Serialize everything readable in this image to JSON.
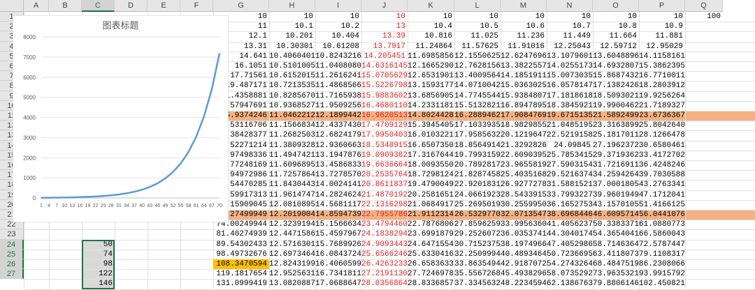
{
  "columns": [
    "A",
    "B",
    "C",
    "D",
    "E",
    "F",
    "G",
    "H",
    "I",
    "J",
    "K",
    "L",
    "M",
    "N",
    "O",
    "P",
    "Q"
  ],
  "selected_column": "C",
  "rows": [
    "1",
    "2",
    "3",
    "4",
    "5",
    "6",
    "7",
    "8",
    "9",
    "10",
    "11",
    "12",
    "13",
    "14",
    "15",
    "16",
    "17",
    "18",
    "19",
    "20",
    "21",
    "22",
    "23",
    "24",
    "25",
    "26",
    "27"
  ],
  "selected_rows": [
    "24",
    "25",
    "26",
    "27"
  ],
  "highlight_rows": [
    "11",
    "21"
  ],
  "colors": {
    "highlight": "#f4b183",
    "red_text": "#e02020",
    "gold": "#ffc000",
    "selection": "#217346",
    "line": "#5b9bd5"
  },
  "grid": [
    [
      "10",
      "10",
      "10",
      "10",
      "10",
      "10",
      "10",
      "10",
      "10",
      "10",
      "100"
    ],
    [
      "11",
      "10.1",
      "10.2",
      "13",
      "10.4",
      "10.5",
      "10.6",
      "10.7",
      "10.8",
      "10.9",
      ""
    ],
    [
      "12.1",
      "10.201",
      "10.404",
      "13.39",
      "10.816",
      "11.025",
      "11.236",
      "11.449",
      "11.664",
      "11.881",
      ""
    ],
    [
      "13.31",
      "10.30301",
      "10.61208",
      "13.7917",
      "11.24864",
      "11.57625",
      "11.91016",
      "12.25043",
      "12.59712",
      "12.95029",
      ""
    ],
    [
      "14.641",
      "10.4060401",
      "10.8243216",
      "14.205451",
      "11.6985856",
      "12.1550625",
      "12.6247696",
      "13.1079601",
      "13.6048896",
      "14.1158161",
      ""
    ],
    [
      "16.1051",
      "10.5101005",
      "11.04080803",
      "14.63161453",
      "12.16652902",
      "12.76281563",
      "13.38225578",
      "14.02551731",
      "14.69328077",
      "15.38623955",
      ""
    ],
    [
      "17.71561",
      "10.61520151",
      "11.26162419",
      "15.07056297",
      "12.65319018",
      "13.40095641",
      "14.18519112",
      "15.00730352",
      "15.86874323",
      "16.77100111",
      ""
    ],
    [
      "19.487171",
      "10.72135352",
      "11.48685668",
      "15.52267985",
      "13.15931779",
      "14.07100423",
      "15.03630259",
      "16.05781476",
      "17.13824269",
      "18.28039121",
      ""
    ],
    [
      "21.4358881",
      "10.82856706",
      "11.71659381",
      "15.98836025",
      "13.6856905",
      "14.77455444",
      "15.93848075",
      "17.1818618",
      "18.5093021",
      "19.92562642",
      ""
    ],
    [
      "23.57947691",
      "10.93685273",
      "11.95092569",
      "16.46801106",
      "14.23311812",
      "15.51328216",
      "16.89478959",
      "18.38459212",
      "19.99004627",
      "21.71893279",
      ""
    ],
    [
      "25.9374246",
      "11.04622125",
      "12.1899442",
      "16.96205139",
      "14.80244285",
      "16.28894627",
      "17.90847697",
      "19.67151357",
      "21.58924997",
      "23.67363675",
      ""
    ],
    [
      "28.53116706",
      "11.15668347",
      "12.43374308",
      "17.47091293",
      "15.39454056",
      "17.10339358",
      "18.98298558",
      "21.04851952",
      "23.31638997",
      "25.80426405",
      ""
    ],
    [
      "31.38428377",
      "11.2682503",
      "12.68241795",
      "17.99504032",
      "16.01032219",
      "17.95856326",
      "20.12196472",
      "22.52191589",
      "25.18170117",
      "28.12664782",
      ""
    ],
    [
      "34.52271214",
      "11.3809328",
      "12.9360663",
      "18.53489153",
      "16.65073507",
      "18.85649142",
      "21.3292826",
      "24.09845",
      "27.19623726",
      "30.65804612",
      ""
    ],
    [
      "37.97498336",
      "11.49474213",
      "13.19478763",
      "19.09093827",
      "17.31676448",
      "19.79931599",
      "22.60903956",
      "25.7853415",
      "29.37193624",
      "33.41727027",
      ""
    ],
    [
      "41.77248169",
      "11.60968955",
      "13.45868338",
      "19.66366642",
      "18.00935506",
      "20.78928179",
      "23.96558193",
      "27.59031541",
      "31.72169114",
      "36.4248246",
      ""
    ],
    [
      "45.94972986",
      "11.72578645",
      "13.72785705",
      "20.25357642",
      "18.72981246",
      "21.82874588",
      "25.40351685",
      "29.52163749",
      "34.25942643",
      "39.70305881",
      ""
    ],
    [
      "50.54470285",
      "11.84304431",
      "14.00241419",
      "20.86118371",
      "19.47900496",
      "22.92018318",
      "26.92772786",
      "31.58815211",
      "37.00018055",
      "43.2763341",
      ""
    ],
    [
      "55.59917313",
      "11.96147476",
      "14.28246248",
      "21.48701922",
      "20.25816515",
      "24.06619234",
      "28.54339153",
      "33.79932276",
      "39.96019499",
      "47.17120417",
      ""
    ],
    [
      "61.15909045",
      "12.0810895",
      "14.56811173",
      "22.1316298",
      "21.06849176",
      "25.26950195",
      "30.25599502",
      "36.16527535",
      "43.15701059",
      "51.41661255",
      ""
    ],
    [
      "67.27499949",
      "12.2019004",
      "14.85947396",
      "22.79557869",
      "21.91123143",
      "26.53297705",
      "32.07135472",
      "38.69684462",
      "46.60957144",
      "56.04410768",
      ""
    ],
    [
      "74.00249944",
      "12.3239194",
      "15.15666344",
      "23.47944605",
      "22.78768069",
      "27.8596259",
      "33.99563601",
      "41.40562375",
      "50.33833715",
      "61.08807737",
      ""
    ],
    [
      "81.40274939",
      "12.4471586",
      "15.45979671",
      "24.18382943",
      "23.69918792",
      "29.2526072",
      "36.03537417",
      "44.30401741",
      "54.36540413",
      "66.58600433",
      ""
    ],
    [
      "89.54302433",
      "12.57163018",
      "15.76899264",
      "24.90934432",
      "24.64715543",
      "30.71523756",
      "38.19749662",
      "47.40529863",
      "58.71463646",
      "72.57874472",
      ""
    ],
    [
      "98.49732676",
      "12.69734649",
      "16.08437249",
      "25.65662464",
      "25.63304165",
      "32.25099944",
      "40.48934641",
      "50.72366953",
      "63.41180737",
      "79.11083175",
      ""
    ],
    [
      "108.3470594",
      "12.82431995",
      "16.40605994",
      "26.42632338",
      "26.65836331",
      "33.86354941",
      "42.9187072",
      "54.2743264",
      "68.48475196",
      "86.2308066",
      ""
    ],
    [
      "119.1817654",
      "12.95256315",
      "16.73418114",
      "27.21911309",
      "27.72469785",
      "35.55672688",
      "45.49382963",
      "58.07352925",
      "73.96353212",
      "93.9915792",
      ""
    ],
    [
      "131.0999419",
      "13.08208878",
      "17.06886477",
      "28.03568648",
      "28.83368576",
      "37.33456322",
      "48.22345941",
      "62.1386763",
      "79.88061469",
      "102.4508213",
      ""
    ]
  ],
  "red_column": "J",
  "gold_cell": "G26",
  "columnC": {
    "24": "50",
    "25": "74",
    "26": "98",
    "27": "122",
    "28": "146"
  },
  "chart_data": {
    "type": "line",
    "title": "图表标题",
    "xlabel": "",
    "ylabel": "",
    "x": [
      1,
      4,
      7,
      10,
      13,
      16,
      19,
      22,
      25,
      28,
      31,
      34,
      37,
      40,
      43,
      46,
      49,
      52,
      55,
      58,
      61,
      64,
      67,
      70
    ],
    "x_tick_labels": [
      "1",
      "4",
      "7",
      "10",
      "13",
      "16",
      "19",
      "22",
      "25",
      "28",
      "31",
      "34",
      "37",
      "40",
      "43",
      "46",
      "49",
      "52",
      "55",
      "58",
      "61",
      "64",
      "67",
      "70"
    ],
    "y_ticks": [
      0,
      1000,
      2000,
      3000,
      4000,
      5000,
      6000,
      7000,
      8000
    ],
    "ylim": [
      0,
      8000
    ],
    "grid": true,
    "series": [
      {
        "values": [
          10,
          13.31,
          17.72,
          23.58,
          31.38,
          41.77,
          55.6,
          74,
          98.5,
          131.1,
          174.5,
          232.3,
          309.1,
          411.4,
          547.6,
          728.8,
          970,
          1291,
          1719,
          2288,
          3045,
          4053,
          5394,
          7180
        ]
      }
    ]
  }
}
